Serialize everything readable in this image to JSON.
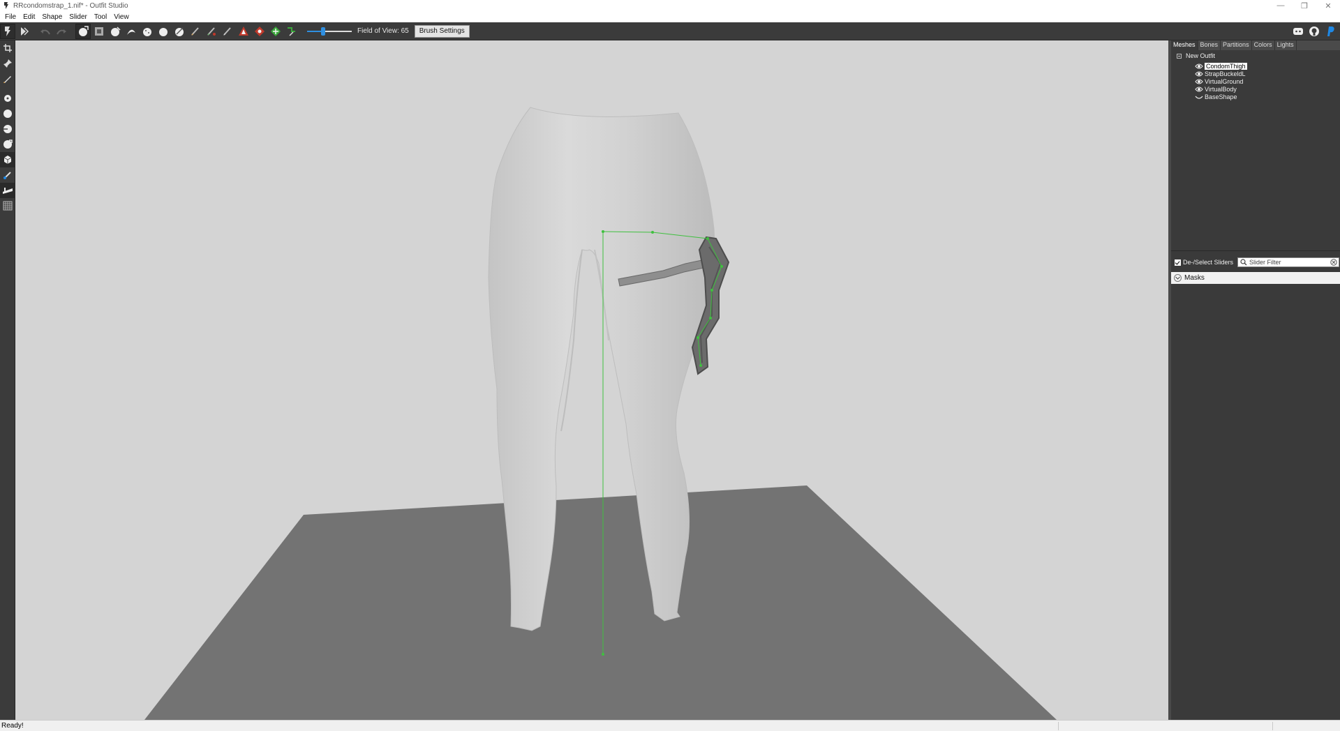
{
  "window": {
    "title": "RRcondomstrap_1.nif* - Outfit Studio",
    "controls": [
      "minimize-icon",
      "restore-icon",
      "close-icon"
    ]
  },
  "menu": [
    "File",
    "Edit",
    "Shape",
    "Slider",
    "Tool",
    "View"
  ],
  "toolbar": {
    "field_of_view_label": "Field of View: 65",
    "field_of_view_value": 65,
    "brush_settings_label": "Brush Settings",
    "icons": [
      "select-brush-icon",
      "transform-icon",
      "undo-icon",
      "redo-icon",
      "inflate-brush-icon",
      "mask-brush-icon",
      "deflate-brush-icon",
      "move-brush-icon",
      "smooth-brush-icon",
      "color-brush-icon",
      "erase-icon",
      "alpha-brush-icon",
      "weight-brush-icon",
      "red-axis-icon",
      "red-rotate-icon",
      "green-move-icon",
      "pivot-icon"
    ],
    "right_icons": [
      "discord-icon",
      "github-icon",
      "paypal-icon"
    ]
  },
  "left_tools": [
    "select-icon",
    "pin-icon",
    "pen-icon",
    "sphere-1-icon",
    "sphere-2-icon",
    "sphere-3-icon",
    "sphere-4-icon",
    "cube-icon",
    "brush-icon",
    "weight-icon",
    "grid-icon"
  ],
  "tabs": [
    {
      "label": "Meshes",
      "active": true
    },
    {
      "label": "Bones",
      "active": false
    },
    {
      "label": "Partitions",
      "active": false
    },
    {
      "label": "Colors",
      "active": false
    },
    {
      "label": "Lights",
      "active": false
    }
  ],
  "mesh_tree": {
    "root": "New Outfit",
    "items": [
      {
        "label": "CondomThigh",
        "selected": true,
        "icon": "eye-icon"
      },
      {
        "label": "StrapBuckeldL",
        "selected": false,
        "icon": "eye-icon"
      },
      {
        "label": "VirtualGround",
        "selected": false,
        "icon": "eye-icon"
      },
      {
        "label": "VirtualBody",
        "selected": false,
        "icon": "eye-icon"
      },
      {
        "label": "BaseShape",
        "selected": false,
        "icon": "closed-eye-icon"
      }
    ]
  },
  "sliders": {
    "deselect_label": "De-/Select Sliders",
    "filter_placeholder": "Slider Filter",
    "masks_label": "Masks"
  },
  "status": {
    "text": "Ready!"
  }
}
